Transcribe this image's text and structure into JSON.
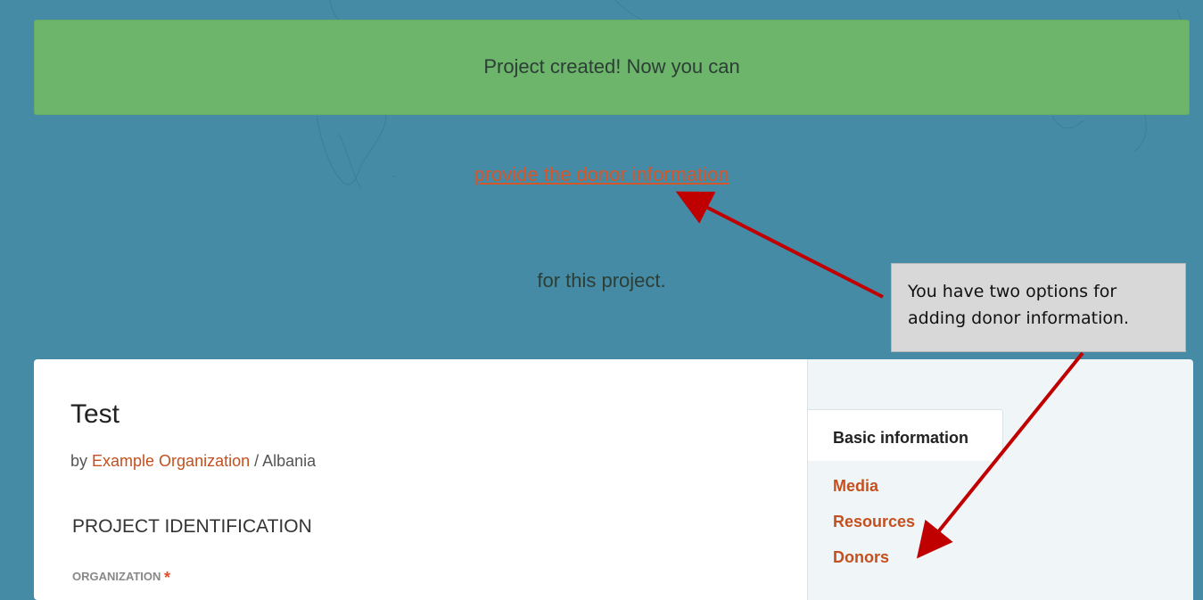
{
  "flash": {
    "line1": "Project created! Now you can",
    "link": "provide the donor information",
    "line3": "for this project."
  },
  "project": {
    "title": "Test",
    "by_prefix": "by ",
    "organization": "Example Organization",
    "separator": " / ",
    "country": "Albania"
  },
  "form": {
    "section_title": "PROJECT IDENTIFICATION",
    "organization_label": "ORGANIZATION",
    "required_marker": "*"
  },
  "sidebar": {
    "active_tab": "Basic information",
    "links": [
      "Media",
      "Resources",
      "Donors"
    ]
  },
  "callout": {
    "text": "You have two options for adding donor information."
  },
  "colors": {
    "background": "#458ba5",
    "flash_green": "#6cb56b",
    "link_orange": "#c4501f",
    "arrow_red": "#c00000"
  }
}
